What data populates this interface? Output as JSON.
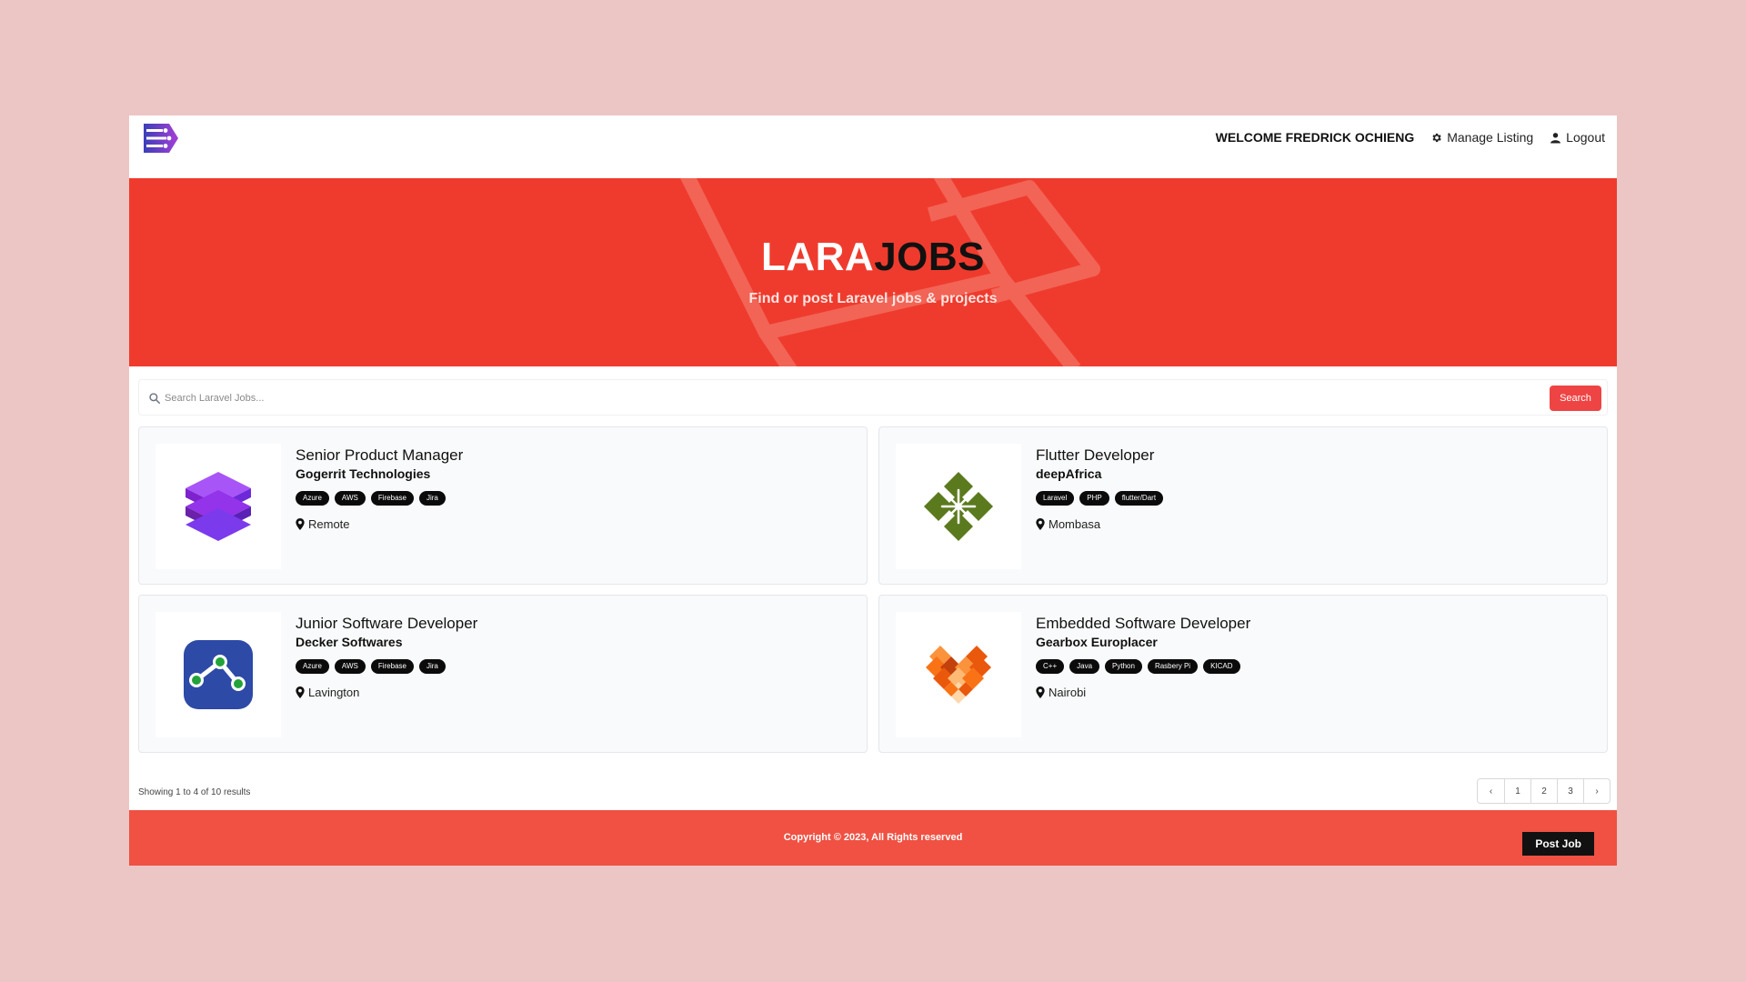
{
  "nav": {
    "welcome": "WELCOME FREDRICK OCHIENG",
    "manage_label": "Manage Listing",
    "logout_label": "Logout"
  },
  "hero": {
    "title_a": "LARA",
    "title_b": "JOBS",
    "subtitle": "Find or post Laravel jobs & projects"
  },
  "search": {
    "placeholder": "Search Laravel Jobs...",
    "button": "Search"
  },
  "jobs": [
    {
      "title": "Senior Product Manager",
      "company": "Gogerrit Technologies",
      "tags": [
        "Azure",
        "AWS",
        "Firebase",
        "Jira"
      ],
      "location": "Remote",
      "logo": "purple-cubes-logo"
    },
    {
      "title": "Flutter Developer",
      "company": "deepAfrica",
      "tags": [
        "Laravel",
        "PHP",
        "flutter/Dart"
      ],
      "location": "Mombasa",
      "logo": "green-clover-logo"
    },
    {
      "title": "Junior Software Developer",
      "company": "Decker Softwares",
      "tags": [
        "Azure",
        "AWS",
        "Firebase",
        "Jira"
      ],
      "location": "Lavington",
      "logo": "blue-network-logo"
    },
    {
      "title": "Embedded Software Developer",
      "company": "Gearbox Europlacer",
      "tags": [
        "C++",
        "Java",
        "Python",
        "Rasbery Pi",
        "KICAD"
      ],
      "location": "Nairobi",
      "logo": "orange-heart-logo"
    }
  ],
  "pagination": {
    "results": "Showing 1 to 4 of 10 results",
    "prev": "‹",
    "pages": [
      "1",
      "2",
      "3"
    ],
    "next": "›"
  },
  "footer": {
    "copyright": "Copyright © 2023, All Rights reserved",
    "post_button": "Post Job"
  },
  "colors": {
    "hero_red": "#ef3b2d",
    "footer_red": "#f05142",
    "background": "#ecc6c5",
    "tag_black": "#0b0b0b"
  }
}
